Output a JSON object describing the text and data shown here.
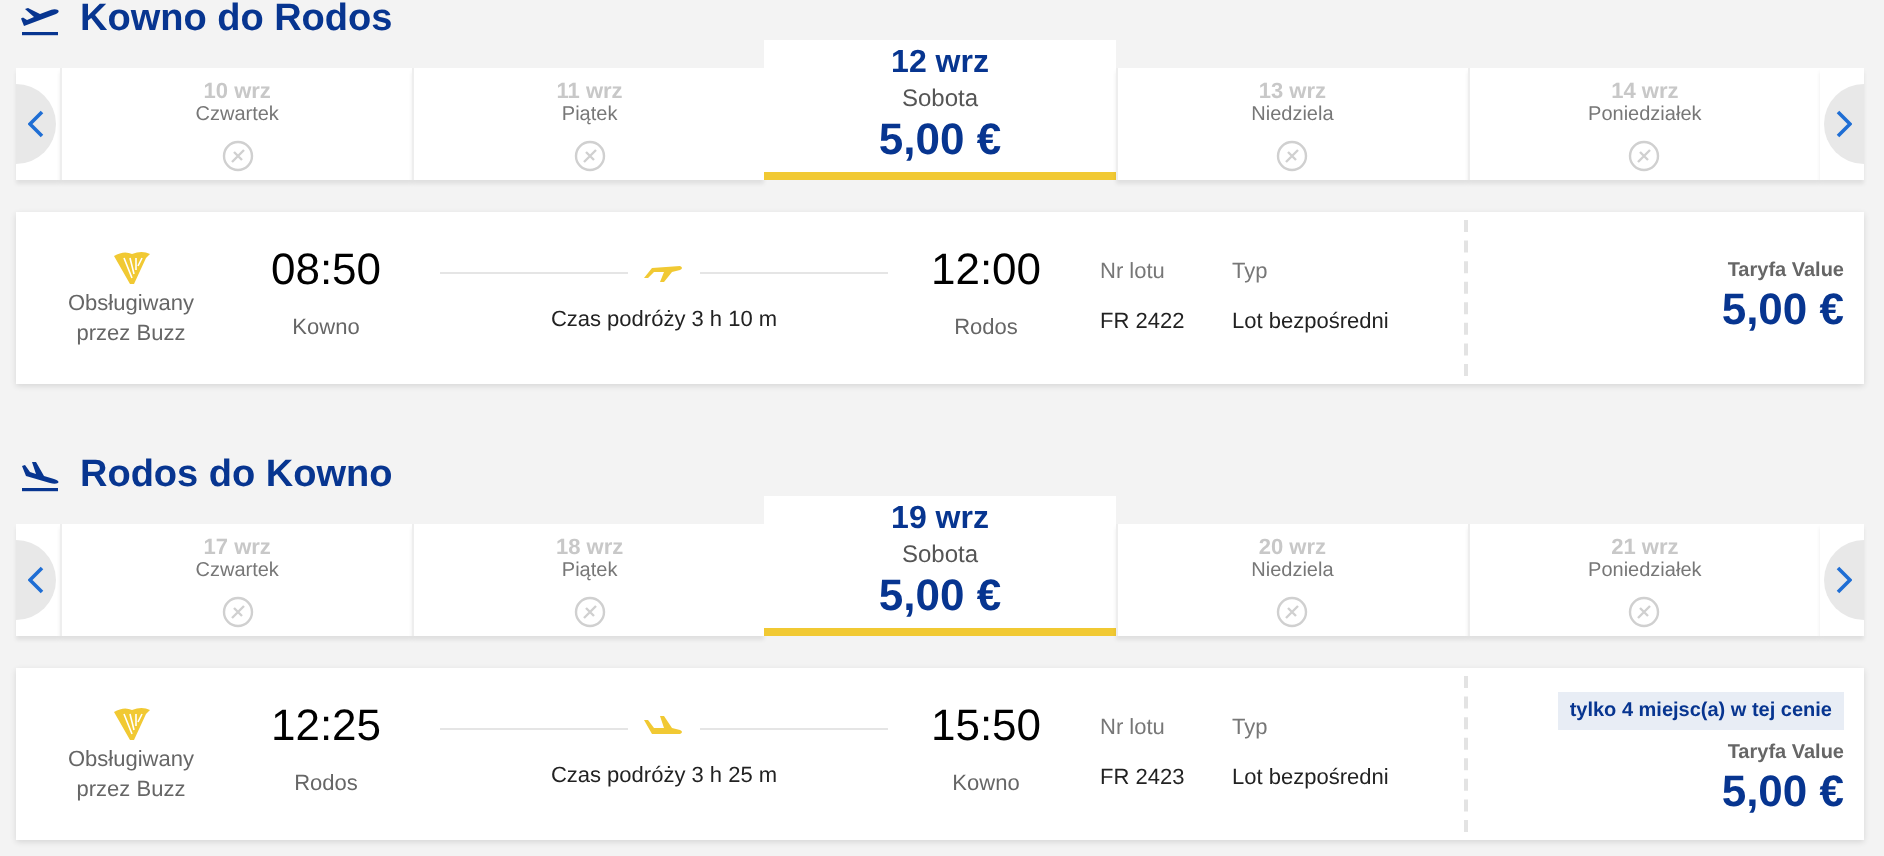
{
  "sections": [
    {
      "kind": "outbound",
      "title": "Kowno do Rodos",
      "dates": [
        {
          "date": "10 wrz",
          "day": "Czwartek",
          "selected": false
        },
        {
          "date": "11 wrz",
          "day": "Piątek",
          "selected": false
        },
        {
          "date": "12 wrz",
          "day": "Sobota",
          "price": "5,00 €",
          "selected": true
        },
        {
          "date": "13 wrz",
          "day": "Niedziela",
          "selected": false
        },
        {
          "date": "14 wrz",
          "day": "Poniedziałek",
          "selected": false
        }
      ],
      "flight": {
        "operator": "Obsługiwany przez Buzz",
        "departure_time": "08:50",
        "departure_city": "Kowno",
        "duration": "Czas podróży 3 h 10 m",
        "arrival_time": "12:00",
        "arrival_city": "Rodos",
        "flight_no_label": "Nr lotu",
        "flight_no": "FR 2422",
        "type_label": "Typ",
        "type": "Lot bezpośredni",
        "fare_label": "Taryfa Value",
        "price": "5,00 €"
      }
    },
    {
      "kind": "inbound",
      "title": "Rodos do Kowno",
      "dates": [
        {
          "date": "17 wrz",
          "day": "Czwartek",
          "selected": false
        },
        {
          "date": "18 wrz",
          "day": "Piątek",
          "selected": false
        },
        {
          "date": "19 wrz",
          "day": "Sobota",
          "price": "5,00 €",
          "selected": true
        },
        {
          "date": "20 wrz",
          "day": "Niedziela",
          "selected": false
        },
        {
          "date": "21 wrz",
          "day": "Poniedziałek",
          "selected": false
        }
      ],
      "flight": {
        "operator": "Obsługiwany przez Buzz",
        "departure_time": "12:25",
        "departure_city": "Rodos",
        "duration": "Czas podróży 3 h 25 m",
        "arrival_time": "15:50",
        "arrival_city": "Kowno",
        "flight_no_label": "Nr lotu",
        "flight_no": "FR 2423",
        "type_label": "Typ",
        "type": "Lot bezpośredni",
        "badge": "tylko 4 miejsc(a) w tej cenie",
        "fare_label": "Taryfa Value",
        "price": "5,00 €"
      }
    }
  ]
}
